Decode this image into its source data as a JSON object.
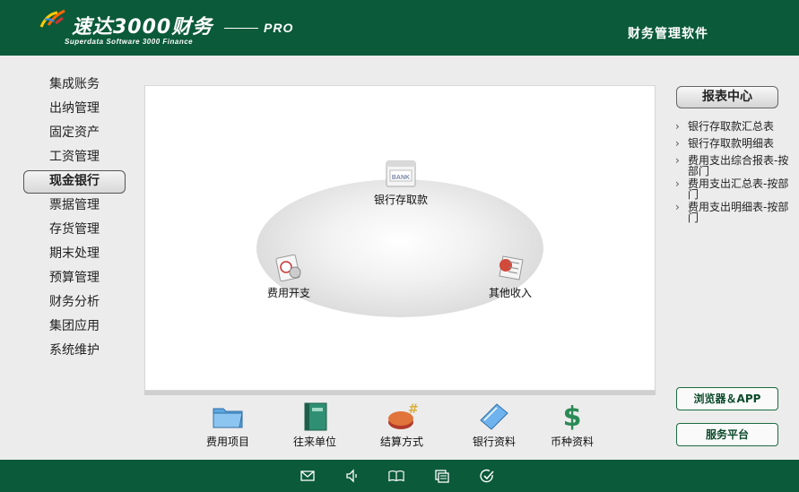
{
  "header": {
    "title": "速达3000财务",
    "subtitle": "Superdata Software 3000 Finance",
    "edition": "PRO",
    "right_label": "财务管理软件"
  },
  "left_nav": {
    "items": [
      {
        "label": "集成账务"
      },
      {
        "label": "出纳管理"
      },
      {
        "label": "固定资产"
      },
      {
        "label": "工资管理"
      },
      {
        "label": "现金银行",
        "active": true
      },
      {
        "label": "票据管理"
      },
      {
        "label": "存货管理"
      },
      {
        "label": "期末处理"
      },
      {
        "label": "预算管理"
      },
      {
        "label": "财务分析"
      },
      {
        "label": "集团应用"
      },
      {
        "label": "系统维护"
      }
    ]
  },
  "main": {
    "hotspots": [
      {
        "label": "银行存取款",
        "icon": "bank-icon",
        "icon_text": "BANK"
      },
      {
        "label": "费用开支",
        "icon": "expense-icon"
      },
      {
        "label": "其他收入",
        "icon": "income-icon"
      }
    ]
  },
  "toolbar": {
    "items": [
      {
        "label": "费用项目",
        "icon": "folder-icon"
      },
      {
        "label": "往来单位",
        "icon": "book-icon"
      },
      {
        "label": "结算方式",
        "icon": "settlement-icon"
      },
      {
        "label": "银行资料",
        "icon": "bank-data-icon"
      },
      {
        "label": "币种资料",
        "icon": "currency-icon"
      }
    ]
  },
  "right_panel": {
    "report_center_label": "报表中心",
    "reports": [
      {
        "label": "银行存取款汇总表"
      },
      {
        "label": "银行存取款明细表"
      },
      {
        "label": "费用支出综合报表-按部门"
      },
      {
        "label": "费用支出汇总表-按部门"
      },
      {
        "label": "费用支出明细表-按部门"
      }
    ],
    "browser_app_label": "浏览器＆APP",
    "service_platform_label": "服务平台"
  },
  "footer": {
    "icons": [
      "mail-icon",
      "speaker-icon",
      "open-book-icon",
      "window-icon",
      "check-circle-icon"
    ]
  },
  "colors": {
    "brand": "#0b5a3a",
    "panel": "#ffffff",
    "background": "#ececec"
  }
}
